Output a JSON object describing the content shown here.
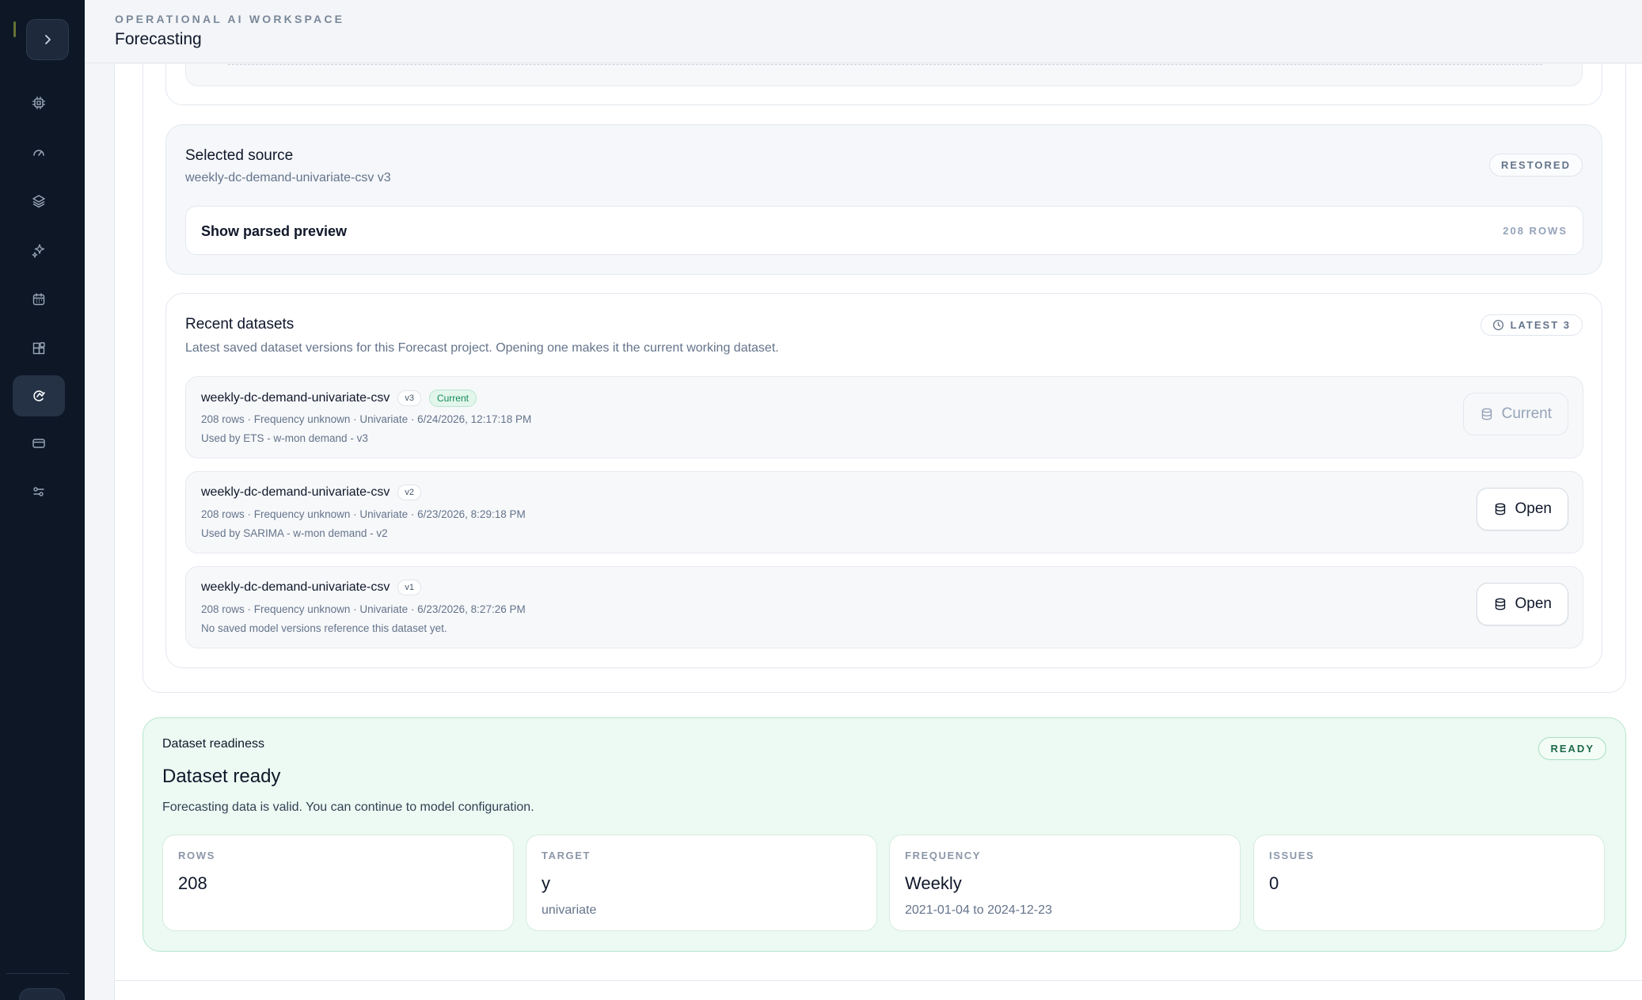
{
  "header": {
    "eyebrow": "OPERATIONAL AI WORKSPACE",
    "title": "Forecasting"
  },
  "sidebar": {
    "toggle_icon": "chevron-right-icon",
    "items": [
      {
        "icon": "chip-icon",
        "active": false
      },
      {
        "icon": "gauge-icon",
        "active": false
      },
      {
        "icon": "layers-icon",
        "active": false
      },
      {
        "icon": "sparkles-icon",
        "active": false
      },
      {
        "icon": "calendar-icon",
        "active": false
      },
      {
        "icon": "blocks-icon",
        "active": false
      },
      {
        "icon": "forecast-icon",
        "active": true
      },
      {
        "icon": "card-icon",
        "active": false
      },
      {
        "icon": "sliders-icon",
        "active": false
      }
    ]
  },
  "source": {
    "title": "Selected source",
    "subtitle": "weekly-dc-demand-univariate-csv v3",
    "status": "RESTORED",
    "preview_label": "Show parsed preview",
    "preview_rows": "208 ROWS"
  },
  "recent": {
    "title": "Recent datasets",
    "description": "Latest saved dataset versions for this Forecast project. Opening one makes it the current working dataset.",
    "badge": "LATEST 3",
    "items": [
      {
        "name": "weekly-dc-demand-univariate-csv",
        "version": "v3",
        "current_badge": "Current",
        "meta": "208 rows · Frequency unknown · Univariate · 6/24/2026, 12:17:18 PM",
        "used": "Used by ETS - w-mon demand - v3",
        "button": "Current"
      },
      {
        "name": "weekly-dc-demand-univariate-csv",
        "version": "v2",
        "meta": "208 rows · Frequency unknown · Univariate · 6/23/2026, 8:29:18 PM",
        "used": "Used by SARIMA - w-mon demand - v2",
        "button": "Open"
      },
      {
        "name": "weekly-dc-demand-univariate-csv",
        "version": "v1",
        "meta": "208 rows · Frequency unknown · Univariate · 6/23/2026, 8:27:26 PM",
        "used": "No saved model versions reference this dataset yet.",
        "button": "Open"
      }
    ]
  },
  "readiness": {
    "eyebrow": "Dataset readiness",
    "title": "Dataset ready",
    "description": "Forecasting data is valid. You can continue to model configuration.",
    "status": "READY",
    "stats": [
      {
        "label": "ROWS",
        "value": "208",
        "sub": ""
      },
      {
        "label": "TARGET",
        "value": "y",
        "sub": "univariate"
      },
      {
        "label": "FREQUENCY",
        "value": "Weekly",
        "sub": "2021-01-04 to 2024-12-23"
      },
      {
        "label": "ISSUES",
        "value": "0",
        "sub": ""
      }
    ]
  },
  "colors": {
    "sidebar_bg": "#0d1726",
    "ready_bg": "#ecfaf3",
    "current_badge": "#138a5a"
  }
}
